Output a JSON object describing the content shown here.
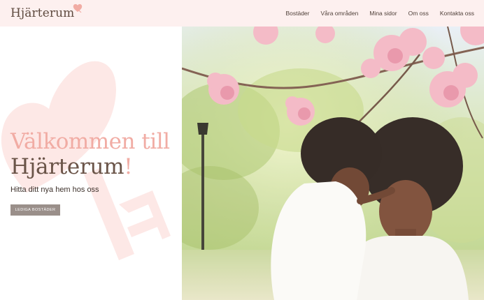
{
  "brand": {
    "name": "Hjärterum",
    "accent_color": "#f1aca4",
    "text_color": "#5e4a3f",
    "header_bg": "#fdf0ef"
  },
  "nav": {
    "items": [
      {
        "label": "Bostäder"
      },
      {
        "label": "Våra områden"
      },
      {
        "label": "Mina sidor"
      },
      {
        "label": "Om oss"
      },
      {
        "label": "Kontakta oss"
      }
    ]
  },
  "hero": {
    "title_line1": "Välkommen till",
    "title_line2": "Hjärterum",
    "title_exclaim": "!",
    "subtitle": "Hitta ditt nya hem hos oss",
    "cta_label": "LEDIGA BOSTÄDER"
  },
  "icons": {
    "logo_heart": "heart-icon",
    "background_decoration": "heart-key-icon"
  }
}
